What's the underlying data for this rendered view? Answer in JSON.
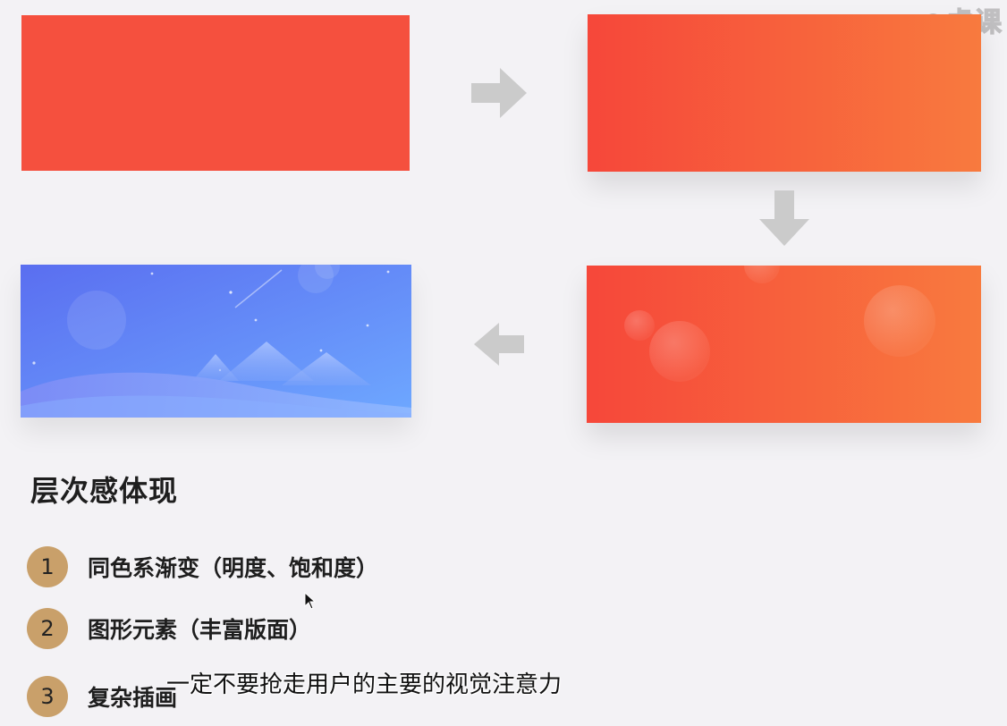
{
  "heading": "层次感体现",
  "list": [
    {
      "number": "1",
      "label": "同色系渐变（明度、饱和度）"
    },
    {
      "number": "2",
      "label": "图形元素（丰富版面）"
    },
    {
      "number": "3",
      "label": "复杂插画"
    }
  ],
  "subtitle": "一定不要抢走用户的主要的视觉注意力",
  "watermark": "虎课",
  "colors": {
    "flat_red": "#f5503e",
    "gradient_start": "#f6473a",
    "gradient_end": "#f87a3e",
    "blue_start": "#5a6ef0",
    "blue_end": "#6ea8ff",
    "number_badge": "#c9a06a",
    "arrow": "#cbcbcb"
  }
}
